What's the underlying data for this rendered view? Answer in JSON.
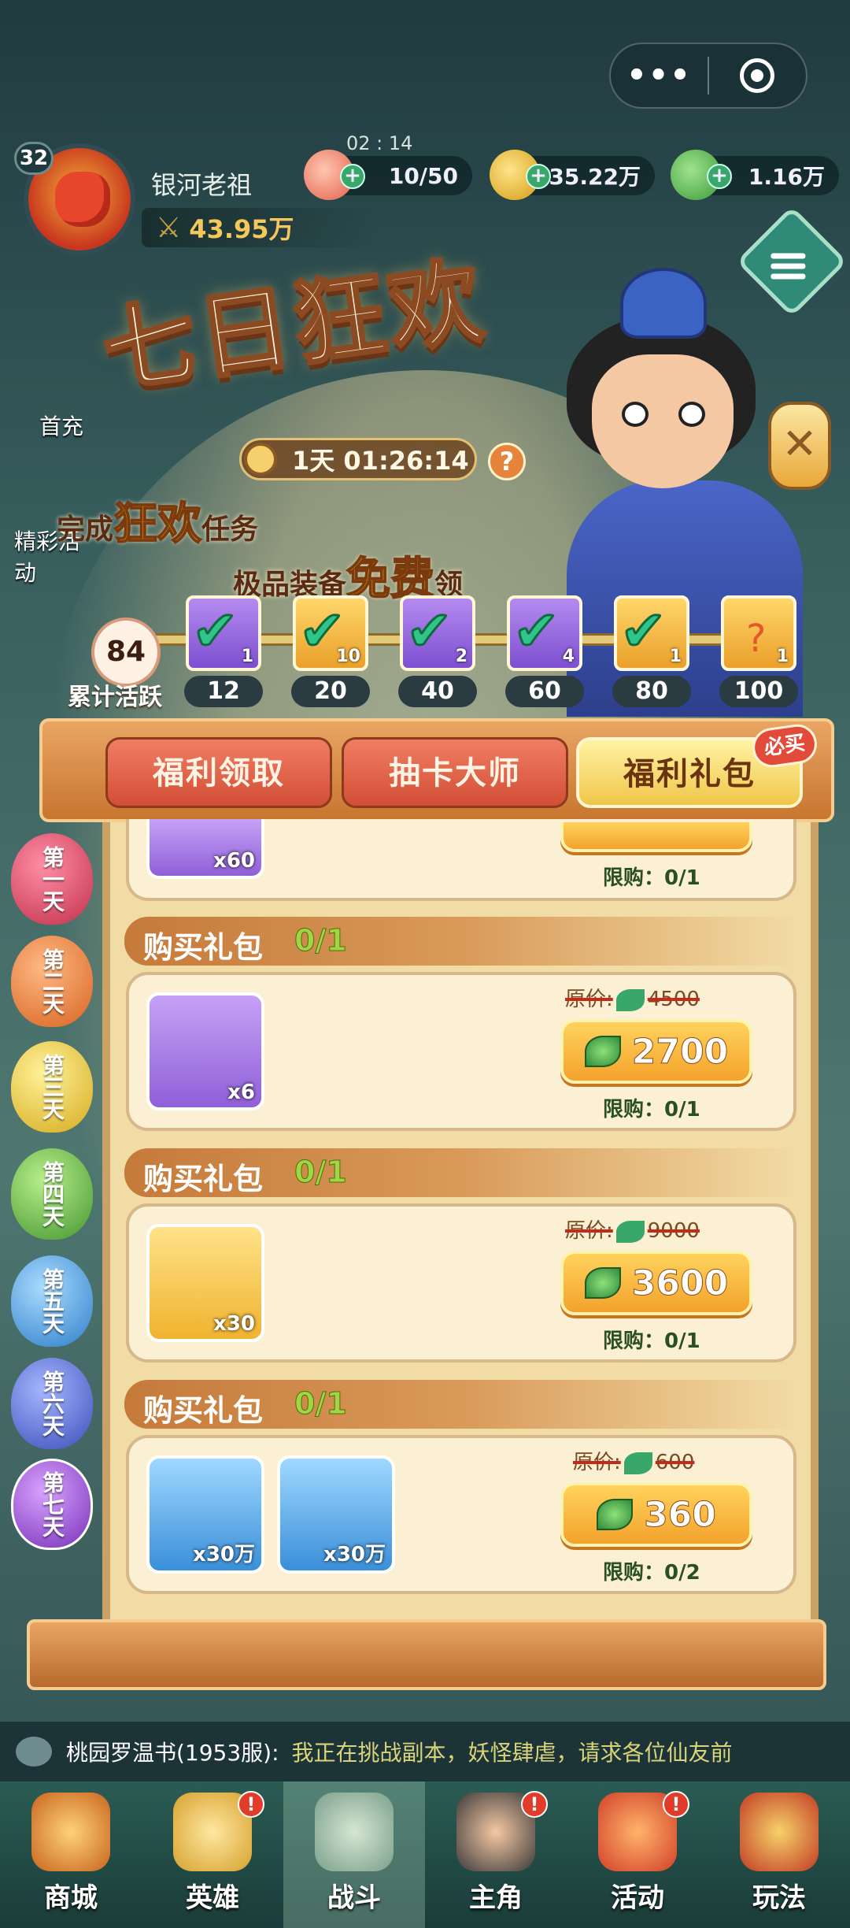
{
  "window": {
    "more_glyph": "•••"
  },
  "player": {
    "level": "32",
    "name": "银河老祖",
    "power": "43.95万",
    "timer": "02 : 14"
  },
  "resources": {
    "stamina": "10/50",
    "coins": "35.22万",
    "jade": "1.16万"
  },
  "event": {
    "title": "七日狂欢",
    "countdown": "1天 01:26:14",
    "help": "?",
    "slogan1": {
      "a": "完成",
      "hl": "狂欢",
      "b": "任务"
    },
    "slogan2": {
      "a": "极品装备",
      "hl": "免费",
      "b": "领"
    },
    "close": "✕"
  },
  "activity": {
    "value": "84",
    "label": "累计活跃",
    "milestones": [
      {
        "value": "12",
        "count": "1",
        "style": "purple",
        "done": true
      },
      {
        "value": "20",
        "count": "10",
        "style": "orange",
        "done": true
      },
      {
        "value": "40",
        "count": "2",
        "style": "purple",
        "done": true
      },
      {
        "value": "60",
        "count": "4",
        "style": "purple",
        "done": true
      },
      {
        "value": "80",
        "count": "1",
        "style": "orange",
        "done": true
      },
      {
        "value": "100",
        "count": "1",
        "style": "orange",
        "done": false
      }
    ]
  },
  "side_days": [
    "第一天",
    "第二天",
    "第三天",
    "第四天",
    "第五天",
    "第六天",
    "第七天"
  ],
  "side_labels": {
    "first_charge": "首充",
    "events": "精彩活动"
  },
  "tabs": {
    "welfare": "福利领取",
    "gacha": "抽卡大师",
    "gift": "福利礼包",
    "must_buy": "必买"
  },
  "packages": [
    {
      "count": "x60",
      "limit": "限购：0/1"
    },
    {
      "title": "购买礼包",
      "quota": "0/1",
      "orig_label": "原价:",
      "orig": "4500",
      "price": "2700",
      "limit": "限购：0/1",
      "items": [
        {
          "count": "x6",
          "icon": "mystery-chest-icon"
        }
      ]
    },
    {
      "title": "购买礼包",
      "quota": "0/1",
      "orig_label": "原价:",
      "orig": "9000",
      "price": "3600",
      "limit": "限购：0/1",
      "items": [
        {
          "count": "x30",
          "icon": "crystal-icon"
        }
      ]
    },
    {
      "title": "购买礼包",
      "quota": "0/1",
      "orig_label": "原价:",
      "orig": "600",
      "price": "360",
      "limit": "限购：0/2",
      "items": [
        {
          "count": "x30万",
          "icon": "blue-orb-icon"
        },
        {
          "count": "x30万",
          "icon": "coin-icon"
        }
      ]
    }
  ],
  "chat": {
    "name": "桃园罗温书(1953服):",
    "message": "我正在挑战副本，妖怪肆虐，请求各位仙友前"
  },
  "nav": [
    "商城",
    "英雄",
    "战斗",
    "主角",
    "活动",
    "玩法"
  ],
  "badge_glyph": "!"
}
